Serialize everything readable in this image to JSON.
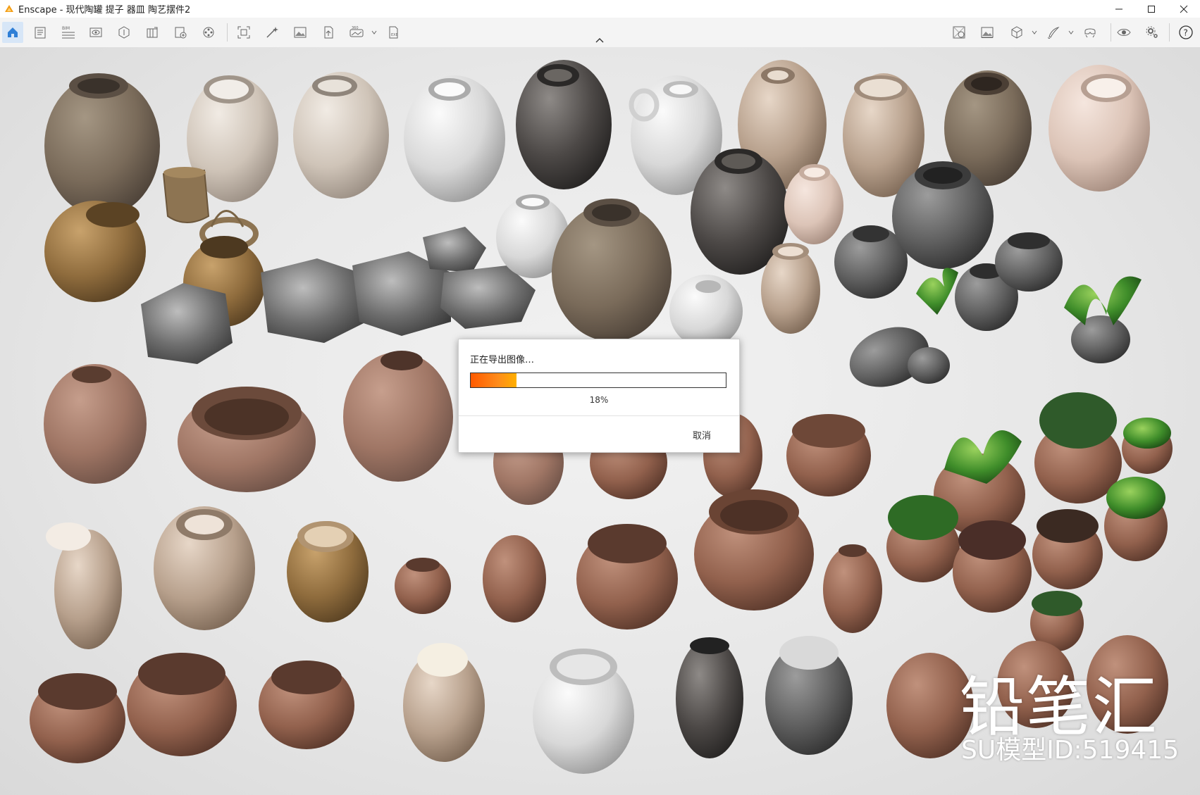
{
  "window": {
    "title": "Enscape - 现代陶罐 提子 器皿 陶艺摆件2"
  },
  "toolbar": {
    "icons": [
      "home-icon",
      "notes-icon",
      "bim-icon",
      "views-icon",
      "assets-icon",
      "materials-icon",
      "atlas-icon",
      "video-icon",
      "screenshot-icon",
      "render-icon",
      "image-icon",
      "upload-icon",
      "panorama-icon",
      "exe-export-icon",
      "walk-icon",
      "capture-icon",
      "cube-icon",
      "brush-icon",
      "vr-icon",
      "eye-icon",
      "settings-icon",
      "help-icon"
    ],
    "bim_label": "BIM"
  },
  "export_dialog": {
    "title": "正在导出图像…",
    "progress": 0.18,
    "progress_label": "18%",
    "cancel_label": "取消"
  },
  "watermark": {
    "brand": "铅笔汇",
    "model_id": "SU模型ID:519415"
  },
  "colors": {
    "progress_start": "#ff5a00",
    "progress_end": "#ffb000",
    "active_tab": "#d7e6f7",
    "home_icon": "#2f7fd6",
    "logo": "#f39c12"
  }
}
